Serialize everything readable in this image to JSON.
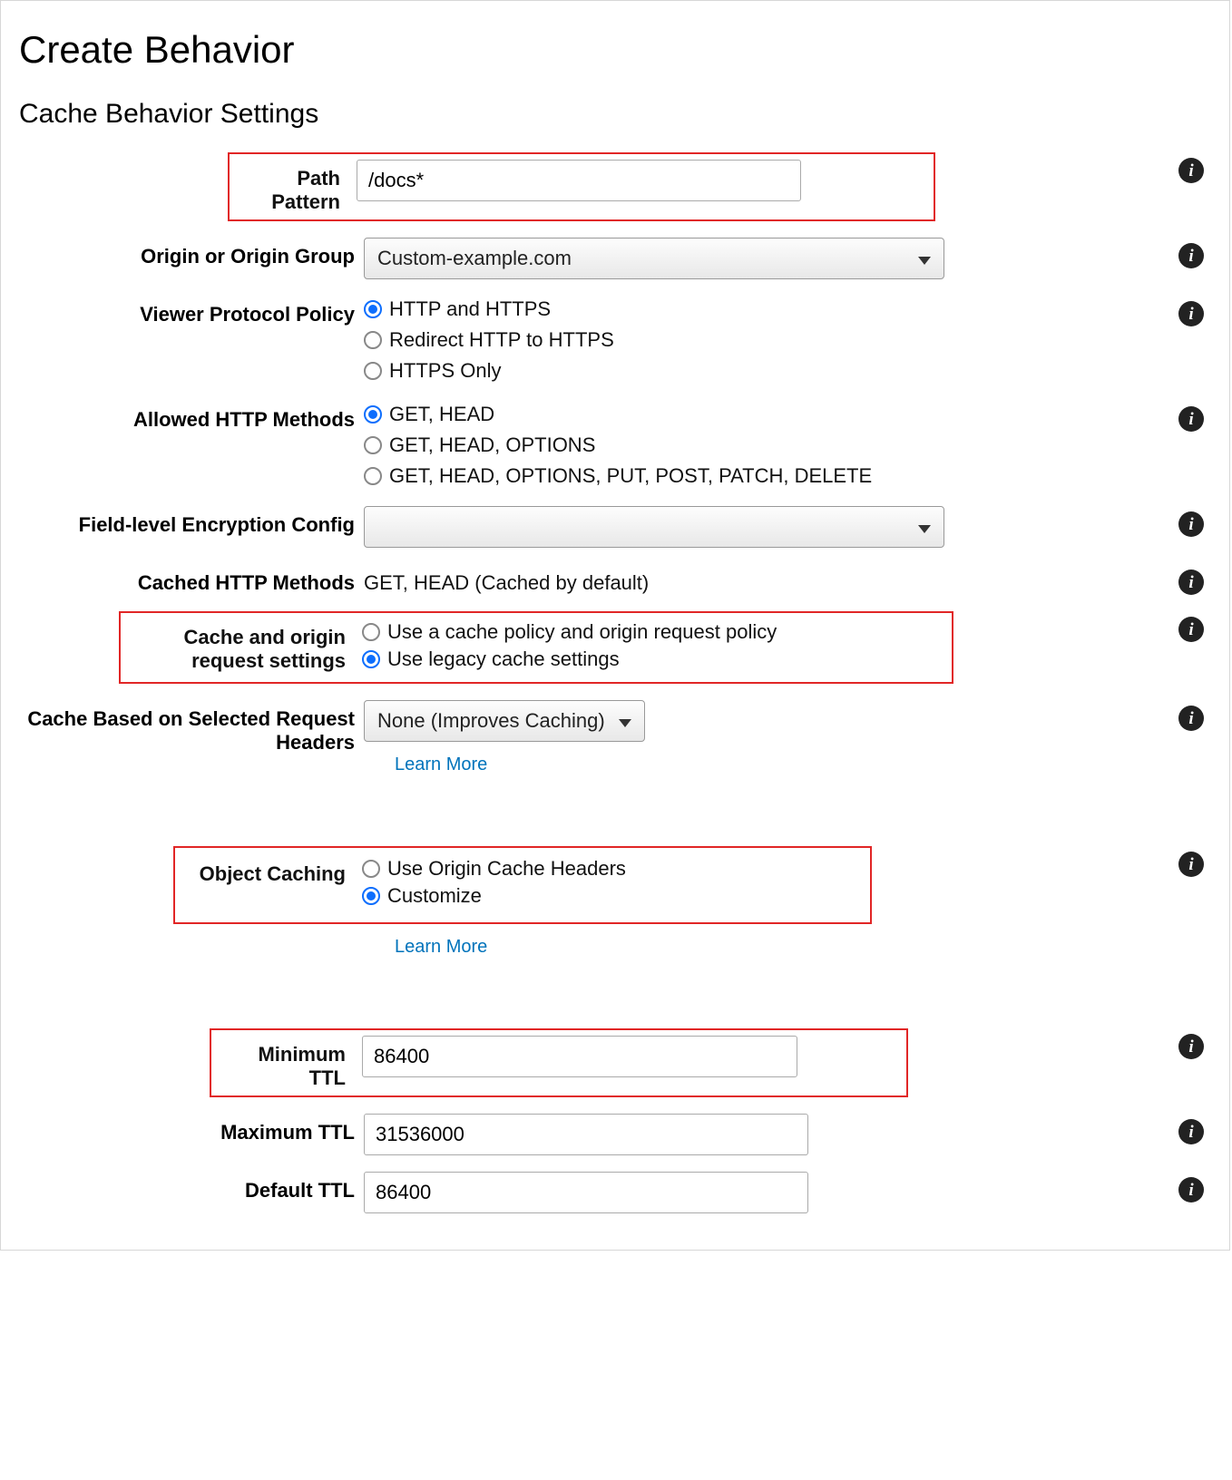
{
  "page_title": "Create Behavior",
  "section_title": "Cache Behavior Settings",
  "info_glyph": "i",
  "path_pattern": {
    "label": "Path Pattern",
    "value": "/docs*"
  },
  "origin_group": {
    "label": "Origin or Origin Group",
    "selected": "Custom-example.com"
  },
  "viewer_protocol": {
    "label": "Viewer Protocol Policy",
    "options": [
      "HTTP and HTTPS",
      "Redirect HTTP to HTTPS",
      "HTTPS Only"
    ],
    "selected_index": 0
  },
  "allowed_methods": {
    "label": "Allowed HTTP Methods",
    "options": [
      "GET, HEAD",
      "GET, HEAD, OPTIONS",
      "GET, HEAD, OPTIONS, PUT, POST, PATCH, DELETE"
    ],
    "selected_index": 0
  },
  "field_encryption": {
    "label": "Field-level Encryption Config",
    "selected": ""
  },
  "cached_methods": {
    "label": "Cached HTTP Methods",
    "value": "GET, HEAD (Cached by default)"
  },
  "cache_origin_settings": {
    "label": "Cache and origin request settings",
    "options": [
      "Use a cache policy and origin request policy",
      "Use legacy cache settings"
    ],
    "selected_index": 1
  },
  "cache_headers": {
    "label": "Cache Based on Selected Request Headers",
    "selected": "None (Improves Caching)",
    "learn_more": "Learn More"
  },
  "object_caching": {
    "label": "Object Caching",
    "options": [
      "Use Origin Cache Headers",
      "Customize"
    ],
    "selected_index": 1,
    "learn_more": "Learn More"
  },
  "min_ttl": {
    "label": "Minimum TTL",
    "value": "86400"
  },
  "max_ttl": {
    "label": "Maximum TTL",
    "value": "31536000"
  },
  "default_ttl": {
    "label": "Default TTL",
    "value": "86400"
  }
}
